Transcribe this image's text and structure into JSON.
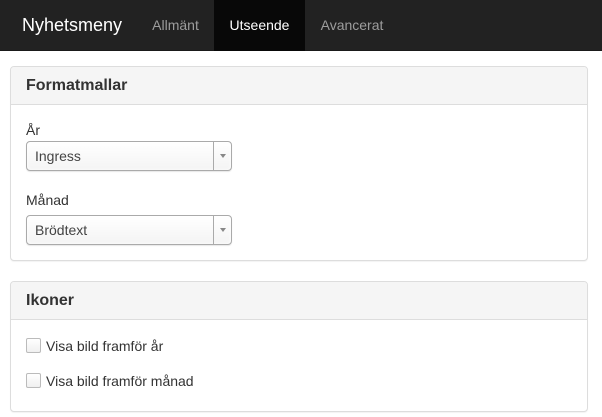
{
  "navbar": {
    "brand": "Nyhetsmeny",
    "tabs": [
      {
        "label": "Allmänt",
        "active": false
      },
      {
        "label": "Utseende",
        "active": true
      },
      {
        "label": "Avancerat",
        "active": false
      }
    ]
  },
  "formats_panel": {
    "title": "Formatmallar",
    "year_label": "År",
    "year_value": "Ingress",
    "month_label": "Månad",
    "month_value": "Brödtext"
  },
  "icons_panel": {
    "title": "Ikoner",
    "checkboxes": [
      {
        "label": "Visa bild framför år",
        "checked": false
      },
      {
        "label": "Visa bild framför månad",
        "checked": false
      }
    ]
  },
  "colors": {
    "navbar_bg": "#222222",
    "active_tab_bg": "#080808",
    "panel_heading_bg": "#f5f5f5"
  }
}
